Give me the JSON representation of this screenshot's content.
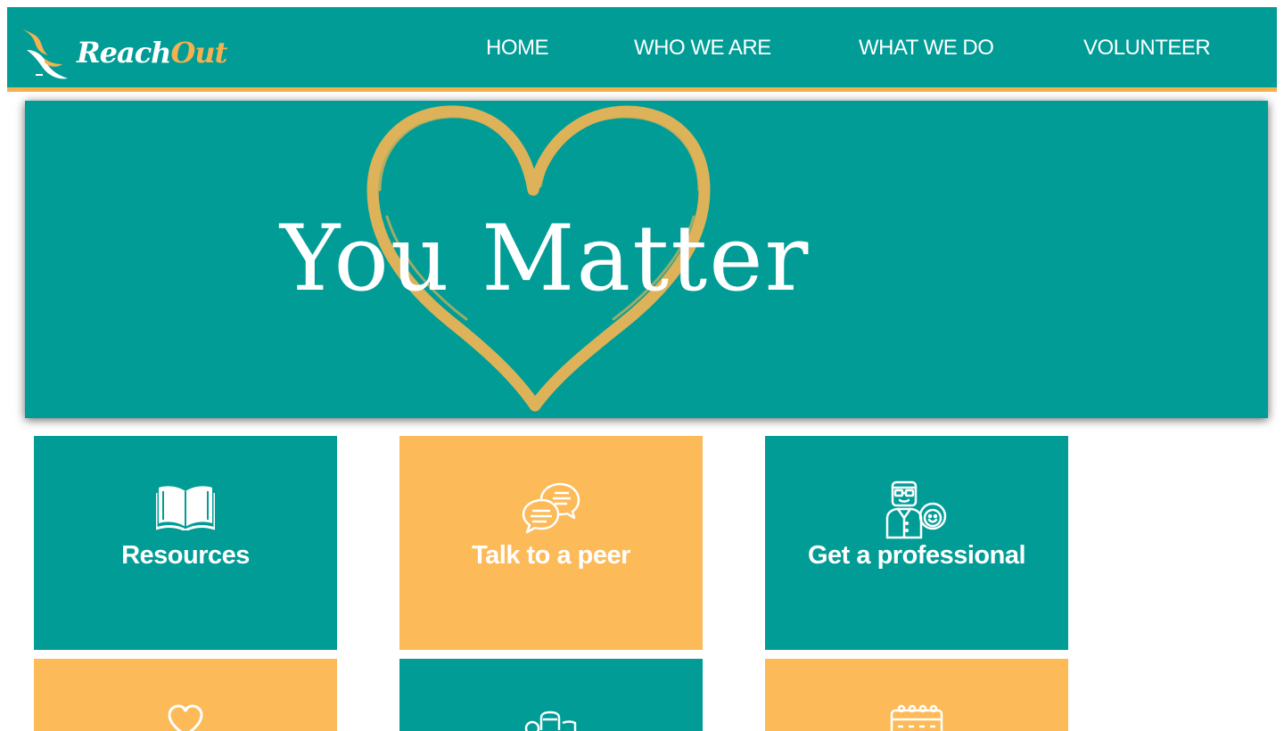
{
  "brand": {
    "logo_word_1": "Reach",
    "logo_word_2": "Out",
    "primary_color": "#019c96",
    "accent_color": "#f3b150",
    "tile_gold_color": "#fdba59"
  },
  "nav": {
    "items": [
      {
        "label": "HOME"
      },
      {
        "label": "WHO WE ARE"
      },
      {
        "label": "WHAT WE DO"
      },
      {
        "label": "VOLUNTEER"
      }
    ]
  },
  "hero": {
    "title": "You Matter",
    "decoration_icon": "heart-outline-icon"
  },
  "tiles": [
    {
      "label": "Resources",
      "icon": "open-book-icon",
      "color": "teal"
    },
    {
      "label": "Talk to a peer",
      "icon": "chat-bubbles-icon",
      "color": "gold"
    },
    {
      "label": "Get a professional",
      "icon": "counselor-icon",
      "color": "teal"
    },
    {
      "label": "",
      "icon": "heart-icon",
      "color": "gold"
    },
    {
      "label": "",
      "icon": "group-icon",
      "color": "teal"
    },
    {
      "label": "",
      "icon": "calendar-icon",
      "color": "gold"
    }
  ]
}
